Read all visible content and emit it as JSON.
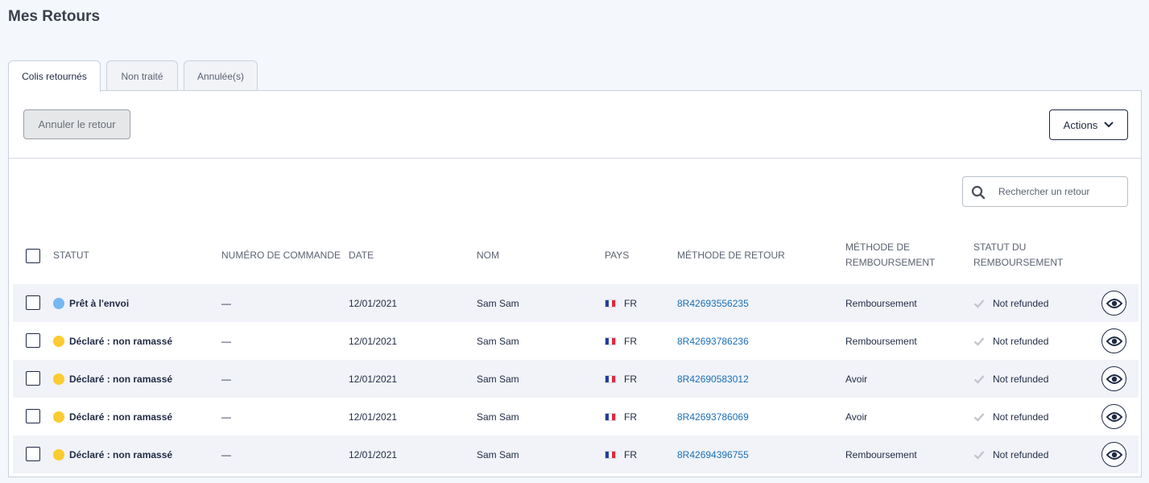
{
  "page": {
    "title": "Mes Retours"
  },
  "tabs": [
    {
      "label": "Colis retournés",
      "active": true
    },
    {
      "label": "Non traité",
      "active": false
    },
    {
      "label": "Annulée(s)",
      "active": false
    }
  ],
  "toolbar": {
    "cancel_label": "Annuler le retour",
    "actions_label": "Actions"
  },
  "search": {
    "placeholder": "Rechercher un retour"
  },
  "table": {
    "headers": {
      "status": "STATUT",
      "order_number": "NUMÉRO DE COMMANDE",
      "date": "DATE",
      "name": "NOM",
      "country": "PAYS",
      "return_method": "MÉTHODE DE RETOUR",
      "refund_method_1": "MÉTHODE DE",
      "refund_method_2": "REMBOURSEMENT",
      "refund_status_1": "STATUT DU",
      "refund_status_2": "REMBOURSEMENT"
    },
    "rows": [
      {
        "status": "Prêt à l'envoi",
        "status_color": "#74b8f5",
        "order": "—",
        "date": "12/01/2021",
        "name": "Sam Sam",
        "country": "FR",
        "return_method": "8R42693556235",
        "refund_method": "Remboursement",
        "refund_status": "Not refunded"
      },
      {
        "status": "Déclaré : non ramassé",
        "status_color": "#fbcb2f",
        "order": "—",
        "date": "12/01/2021",
        "name": "Sam Sam",
        "country": "FR",
        "return_method": "8R42693786236",
        "refund_method": "Remboursement",
        "refund_status": "Not refunded"
      },
      {
        "status": "Déclaré : non ramassé",
        "status_color": "#fbcb2f",
        "order": "—",
        "date": "12/01/2021",
        "name": "Sam Sam",
        "country": "FR",
        "return_method": "8R42690583012",
        "refund_method": "Avoir",
        "refund_status": "Not refunded"
      },
      {
        "status": "Déclaré : non ramassé",
        "status_color": "#fbcb2f",
        "order": "—",
        "date": "12/01/2021",
        "name": "Sam Sam",
        "country": "FR",
        "return_method": "8R42693786069",
        "refund_method": "Avoir",
        "refund_status": "Not refunded"
      },
      {
        "status": "Déclaré : non ramassé",
        "status_color": "#fbcb2f",
        "order": "—",
        "date": "12/01/2021",
        "name": "Sam Sam",
        "country": "FR",
        "return_method": "8R42694396755",
        "refund_method": "Remboursement",
        "refund_status": "Not refunded"
      }
    ]
  },
  "icons": {
    "search": "search-icon",
    "chevron": "chevron-down-icon",
    "flag": "flag-fr-icon",
    "check": "check-icon",
    "view": "eye-icon"
  },
  "colors": {
    "link": "#1a6fb5",
    "primary": "#1f2a44",
    "ready_dot": "#74b8f5",
    "declared_dot": "#fbcb2f"
  }
}
